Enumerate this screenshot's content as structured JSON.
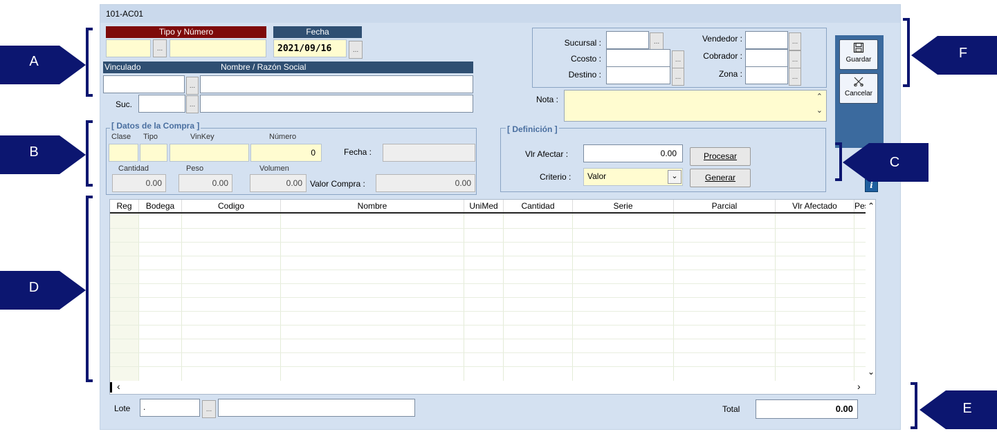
{
  "window": {
    "title": "101-AC01"
  },
  "doc": {
    "tipo_numero_header": "Tipo y Número",
    "fecha_header": "Fecha",
    "fecha_value": "2021/09/16",
    "vinculado_header": "Vinculado",
    "nombre_header": "Nombre / Razón Social",
    "suc_label": "Suc.",
    "dots": "..."
  },
  "right_fields": {
    "sucursal": "Sucursal :",
    "ccosto": "Ccosto :",
    "destino": "Destino :",
    "vendedor": "Vendedor :",
    "cobrador": "Cobrador :",
    "zona": "Zona :",
    "nota": "Nota :"
  },
  "toolbar": {
    "save_label": "Guardar",
    "cancel_label": "Cancelar"
  },
  "compra": {
    "title": "[ Datos de la Compra ]",
    "clase": "Clase",
    "tipo": "Tipo",
    "vinkey": "VinKey",
    "numero": "Número",
    "numero_value": "0",
    "fecha": "Fecha :",
    "cantidad": "Cantidad",
    "cantidad_value": "0.00",
    "peso": "Peso",
    "peso_value": "0.00",
    "volumen": "Volumen",
    "volumen_value": "0.00",
    "valor_compra": "Valor Compra :",
    "valor_compra_value": "0.00"
  },
  "definicion": {
    "title": "[ Definición ]",
    "vlr_afectar": "Vlr Afectar :",
    "vlr_afectar_value": "0.00",
    "criterio": "Criterio :",
    "criterio_value": "Valor",
    "procesar": "Procesar",
    "generar": "Generar"
  },
  "grid": {
    "columns": [
      "Reg",
      "Bodega",
      "Codigo",
      "Nombre",
      "UniMed",
      "Cantidad",
      "Serie",
      "Parcial",
      "Vlr Afectado",
      "Pes"
    ]
  },
  "footer": {
    "lote_label": "Lote",
    "lote_value": ".",
    "total_label": "Total",
    "total_value": "0.00"
  },
  "callouts": {
    "a": "A",
    "b": "B",
    "c": "C",
    "d": "D",
    "e": "E",
    "f": "F"
  }
}
